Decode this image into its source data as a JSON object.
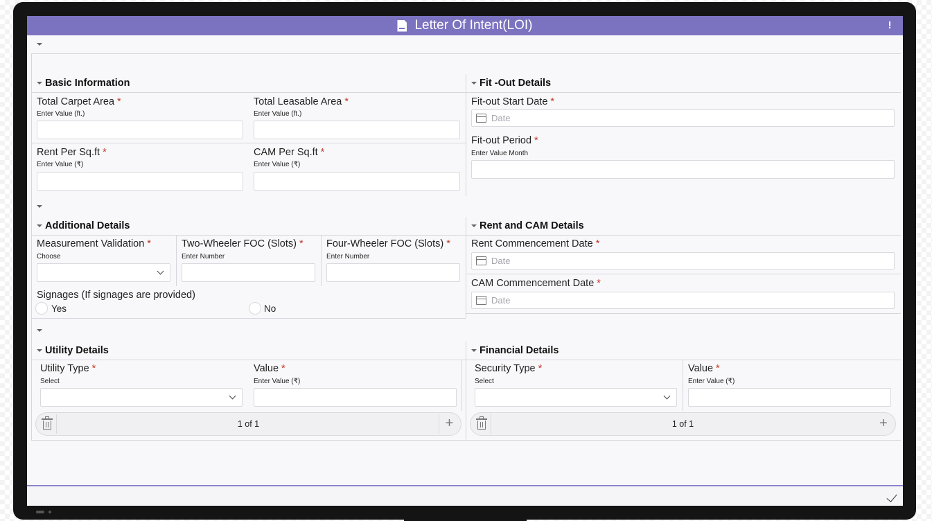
{
  "window": {
    "title": "Letter Of Intent(LOI)"
  },
  "basic_information": {
    "title": "Basic Information",
    "total_carpet_area": {
      "label": "Total Carpet Area",
      "required": "*",
      "hint": "Enter Value (ft.)",
      "value": ""
    },
    "total_leasable_area": {
      "label": "Total Leasable Area",
      "required": "*",
      "hint": "Enter Value (ft.)",
      "value": ""
    },
    "rent_per_sqft": {
      "label": "Rent Per Sq.ft",
      "required": "*",
      "hint": "Enter Value (₹)",
      "value": ""
    },
    "cam_per_sqft": {
      "label": "CAM Per Sq.ft",
      "required": "*",
      "hint": "Enter Value (₹)",
      "value": ""
    }
  },
  "fit_out_details": {
    "title": "Fit -Out Details",
    "start_date": {
      "label": "Fit-out Start Date",
      "required": "*",
      "placeholder": "Date"
    },
    "period": {
      "label": "Fit-out Period",
      "required": "*",
      "hint": "Enter Value Month",
      "value": ""
    }
  },
  "additional_details": {
    "title": "Additional Details",
    "measurement_validation": {
      "label": "Measurement Validation",
      "required": "*",
      "hint": "Choose",
      "value": ""
    },
    "two_wheeler": {
      "label": "Two-Wheeler FOC (Slots)",
      "required": "*",
      "hint": "Enter Number",
      "value": ""
    },
    "four_wheeler": {
      "label": "Four-Wheeler FOC (Slots)",
      "required": "*",
      "hint": "Enter Number",
      "value": ""
    },
    "signages": {
      "label": "Signages (If signages are provided)",
      "options": [
        "Yes",
        "No"
      ]
    }
  },
  "rent_cam_details": {
    "title": "Rent and CAM Details",
    "rent_commencement": {
      "label": "Rent Commencement Date",
      "required": "*",
      "placeholder": "Date"
    },
    "cam_commencement": {
      "label": "CAM Commencement Date",
      "required": "*",
      "placeholder": "Date"
    }
  },
  "utility_details": {
    "title": "Utility Details",
    "utility_type": {
      "label": "Utility Type",
      "required": "*",
      "hint": "Select",
      "value": ""
    },
    "value": {
      "label": "Value",
      "required": "*",
      "hint": "Enter Value (₹)",
      "value": ""
    },
    "pager": {
      "text": "1 of 1",
      "add": "+"
    }
  },
  "financial_details": {
    "title": "Financial Details",
    "security_type": {
      "label": "Security Type",
      "required": "*",
      "hint": "Select",
      "value": ""
    },
    "value": {
      "label": "Value",
      "required": "*",
      "hint": "Enter Value (₹)",
      "value": ""
    },
    "pager": {
      "text": "1 of 1",
      "add": "+"
    }
  },
  "icons": {
    "title": "document-icon",
    "alert": "alert-icon",
    "date": "calendar-icon",
    "delete": "trash-icon",
    "submit": "checkmark-icon"
  },
  "colors": {
    "accent": "#7b72c0",
    "required": "#c0392b"
  }
}
